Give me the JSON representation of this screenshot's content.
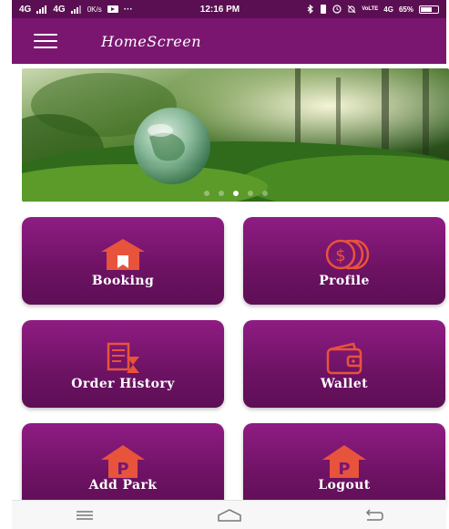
{
  "status_bar": {
    "network_left": "4G",
    "network_mid": "4G",
    "speed": "0K/s",
    "dots": "···",
    "time": "12:16 PM",
    "lte": "VoLTE",
    "network_right": "4G",
    "battery": "65%",
    "battery_level": 0.65
  },
  "app_bar": {
    "title": "HomeScreen",
    "menu_icon": "hamburger-icon"
  },
  "banner": {
    "image": "globe-in-forest",
    "slides": 5,
    "active_slide": 2
  },
  "tiles": [
    {
      "label": "Booking",
      "icon": "house-icon"
    },
    {
      "label": "Profile",
      "icon": "coins-icon"
    },
    {
      "label": "Order History",
      "icon": "receipt-hourglass-icon"
    },
    {
      "label": "Wallet",
      "icon": "wallet-icon"
    },
    {
      "label": "Add Park",
      "icon": "parking-house-icon"
    },
    {
      "label": "Logout",
      "icon": "parking-house-icon"
    }
  ],
  "nav_bar": {
    "menu": "menu-icon",
    "home": "home-icon",
    "back": "back-icon"
  },
  "colors": {
    "app_bar": "#7a1670",
    "tile_top": "#8f1c83",
    "tile_bottom": "#5d0f55",
    "icon_accent": "#e8533b"
  }
}
